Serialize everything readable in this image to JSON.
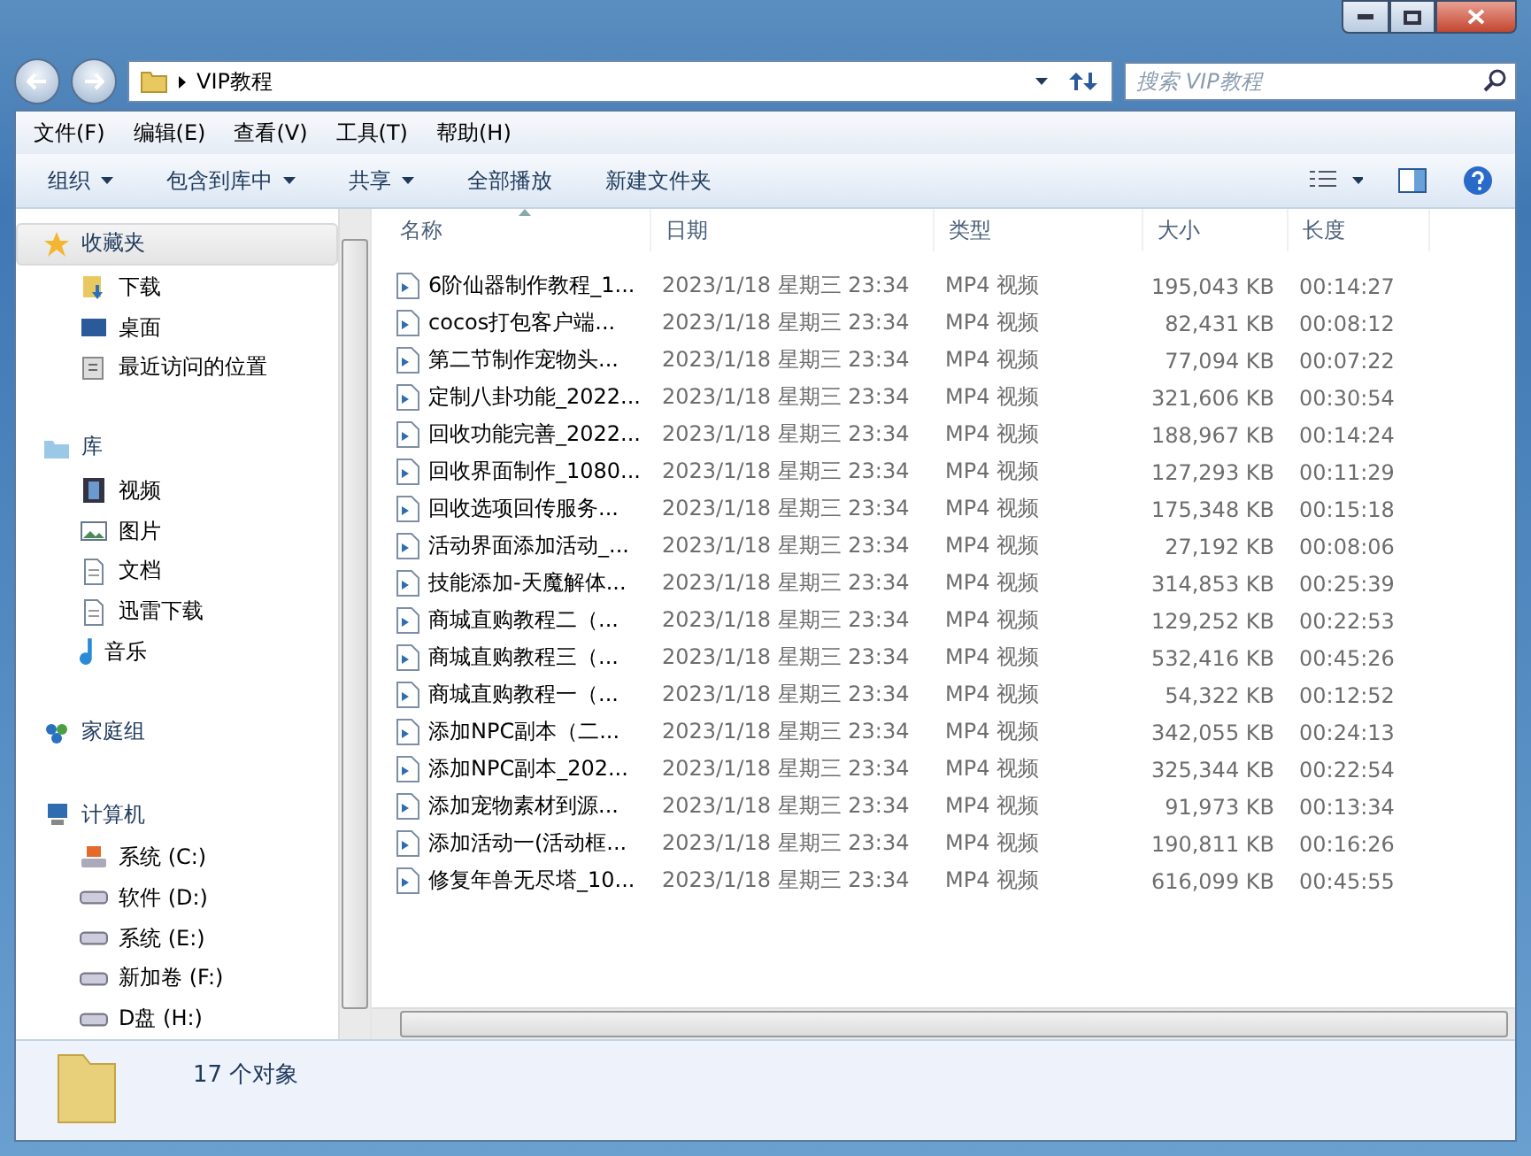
{
  "address": {
    "path": "VIP教程"
  },
  "search": {
    "placeholder": "搜索 VIP教程"
  },
  "menu": [
    "文件(F)",
    "编辑(E)",
    "查看(V)",
    "工具(T)",
    "帮助(H)"
  ],
  "toolbar": [
    {
      "label": "组织",
      "dropdown": true
    },
    {
      "label": "包含到库中",
      "dropdown": true
    },
    {
      "label": "共享",
      "dropdown": true
    },
    {
      "label": "全部播放",
      "dropdown": false
    },
    {
      "label": "新建文件夹",
      "dropdown": false
    }
  ],
  "sidebar": {
    "groups": [
      {
        "label": "收藏夹",
        "kind": "favorites",
        "selected": true,
        "children": [
          {
            "label": "下载",
            "kind": "download"
          },
          {
            "label": "桌面",
            "kind": "desktop"
          },
          {
            "label": "最近访问的位置",
            "kind": "recent"
          }
        ]
      },
      {
        "label": "库",
        "kind": "library",
        "selected": false,
        "children": [
          {
            "label": "视频",
            "kind": "video"
          },
          {
            "label": "图片",
            "kind": "picture"
          },
          {
            "label": "文档",
            "kind": "document"
          },
          {
            "label": "迅雷下载",
            "kind": "document"
          },
          {
            "label": "音乐",
            "kind": "music"
          }
        ]
      },
      {
        "label": "家庭组",
        "kind": "homegroup",
        "selected": false
      },
      {
        "label": "计算机",
        "kind": "computer",
        "selected": false,
        "children": [
          {
            "label": "系统 (C:)",
            "kind": "system-drive"
          },
          {
            "label": "软件 (D:)",
            "kind": "drive"
          },
          {
            "label": "系统 (E:)",
            "kind": "drive"
          },
          {
            "label": "新加卷 (F:)",
            "kind": "drive"
          },
          {
            "label": "D盘 (H:)",
            "kind": "drive"
          }
        ]
      }
    ]
  },
  "table": {
    "columns": [
      {
        "label": "名称",
        "sorted": true
      },
      {
        "label": "日期",
        "sorted": false
      },
      {
        "label": "类型",
        "sorted": false
      },
      {
        "label": "大小",
        "sorted": false
      },
      {
        "label": "长度",
        "sorted": false
      }
    ],
    "rows": [
      [
        "6阶仙器制作教程_1...",
        "2023/1/18 星期三 23:34",
        "MP4 视频",
        "195,043 KB",
        "00:14:27"
      ],
      [
        "cocos打包客户端...",
        "2023/1/18 星期三 23:34",
        "MP4 视频",
        "82,431 KB",
        "00:08:12"
      ],
      [
        "第二节制作宠物头...",
        "2023/1/18 星期三 23:34",
        "MP4 视频",
        "77,094 KB",
        "00:07:22"
      ],
      [
        "定制八卦功能_2022...",
        "2023/1/18 星期三 23:34",
        "MP4 视频",
        "321,606 KB",
        "00:30:54"
      ],
      [
        "回收功能完善_2022...",
        "2023/1/18 星期三 23:34",
        "MP4 视频",
        "188,967 KB",
        "00:14:24"
      ],
      [
        "回收界面制作_1080...",
        "2023/1/18 星期三 23:34",
        "MP4 视频",
        "127,293 KB",
        "00:11:29"
      ],
      [
        "回收选项回传服务...",
        "2023/1/18 星期三 23:34",
        "MP4 视频",
        "175,348 KB",
        "00:15:18"
      ],
      [
        "活动界面添加活动_...",
        "2023/1/18 星期三 23:34",
        "MP4 视频",
        "27,192 KB",
        "00:08:06"
      ],
      [
        "技能添加-天魔解体...",
        "2023/1/18 星期三 23:34",
        "MP4 视频",
        "314,853 KB",
        "00:25:39"
      ],
      [
        "商城直购教程二（...",
        "2023/1/18 星期三 23:34",
        "MP4 视频",
        "129,252 KB",
        "00:22:53"
      ],
      [
        "商城直购教程三（...",
        "2023/1/18 星期三 23:34",
        "MP4 视频",
        "532,416 KB",
        "00:45:26"
      ],
      [
        "商城直购教程一（...",
        "2023/1/18 星期三 23:34",
        "MP4 视频",
        "54,322 KB",
        "00:12:52"
      ],
      [
        "添加NPC副本（二...",
        "2023/1/18 星期三 23:34",
        "MP4 视频",
        "342,055 KB",
        "00:24:13"
      ],
      [
        "添加NPC副本_202...",
        "2023/1/18 星期三 23:34",
        "MP4 视频",
        "325,344 KB",
        "00:22:54"
      ],
      [
        "添加宠物素材到源...",
        "2023/1/18 星期三 23:34",
        "MP4 视频",
        "91,973 KB",
        "00:13:34"
      ],
      [
        "添加活动一(活动框...",
        "2023/1/18 星期三 23:34",
        "MP4 视频",
        "190,811 KB",
        "00:16:26"
      ],
      [
        "修复年兽无尽塔_10...",
        "2023/1/18 星期三 23:34",
        "MP4 视频",
        "616,099 KB",
        "00:45:55"
      ]
    ]
  },
  "status_bar": {
    "count": "17 个对象"
  }
}
